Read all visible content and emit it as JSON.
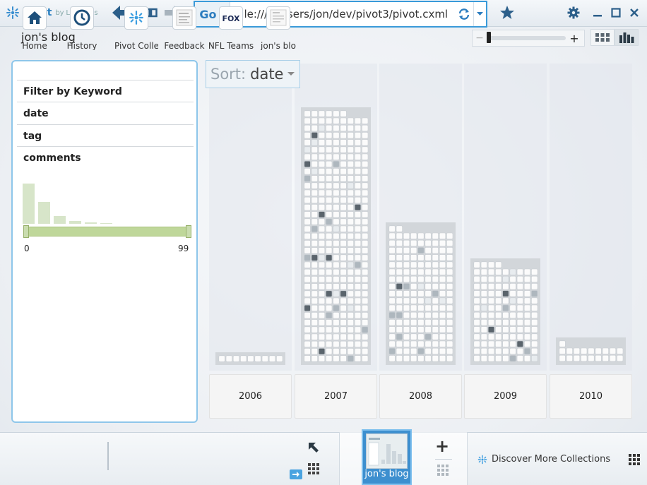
{
  "app": {
    "name": "Pivot",
    "byline": "by Live Labs"
  },
  "toolbar": {
    "back_icon": "back-arrow-icon",
    "tabs_icon": "tab-strip-icon",
    "forward_icon": "forward-arrow-icon",
    "go_label": "Go ›",
    "url": "file:///c:/users/jon/dev/pivot3/pivot.cxml",
    "refresh_icon": "refresh-icon",
    "favorite_icon": "star-icon",
    "settings_icon": "gear-icon"
  },
  "page": {
    "title": "jon's blog"
  },
  "zoom": {
    "level": 0.0,
    "minus": "−",
    "plus": "+"
  },
  "views": {
    "grid_icon": "grid-view-icon",
    "graph_icon": "graph-view-icon",
    "active": "graph"
  },
  "filter": {
    "facets": [
      "Filter by Keyword",
      "date",
      "tag",
      "comments"
    ],
    "histogram": [
      0.92,
      0.5,
      0.17,
      0.06,
      0.03,
      0.02
    ],
    "range_min": "0",
    "range_max": "99"
  },
  "sort": {
    "label": "Sort:",
    "value": "date"
  },
  "chart_data": {
    "type": "bar",
    "categories": [
      "2006",
      "2007",
      "2008",
      "2009",
      "2010"
    ],
    "values": [
      9,
      312,
      164,
      121,
      19
    ],
    "ylabel": "",
    "xlabel": ""
  },
  "bottom": {
    "tabs": [
      {
        "label": "Home",
        "icon": "home-icon"
      },
      {
        "label": "History",
        "icon": "clock-icon"
      },
      {
        "label": "Pivot Collec",
        "icon": "pivot-logo-icon"
      },
      {
        "label": "Feedback",
        "icon": "feedback-page-icon"
      },
      {
        "label": "NFL Teams",
        "icon": "fox-logo-icon"
      },
      {
        "label": "jon's blo",
        "icon": "blog-page-icon"
      }
    ],
    "active_tab": "jon's blog",
    "new_tab": "+",
    "discover": "Discover More Collections"
  }
}
